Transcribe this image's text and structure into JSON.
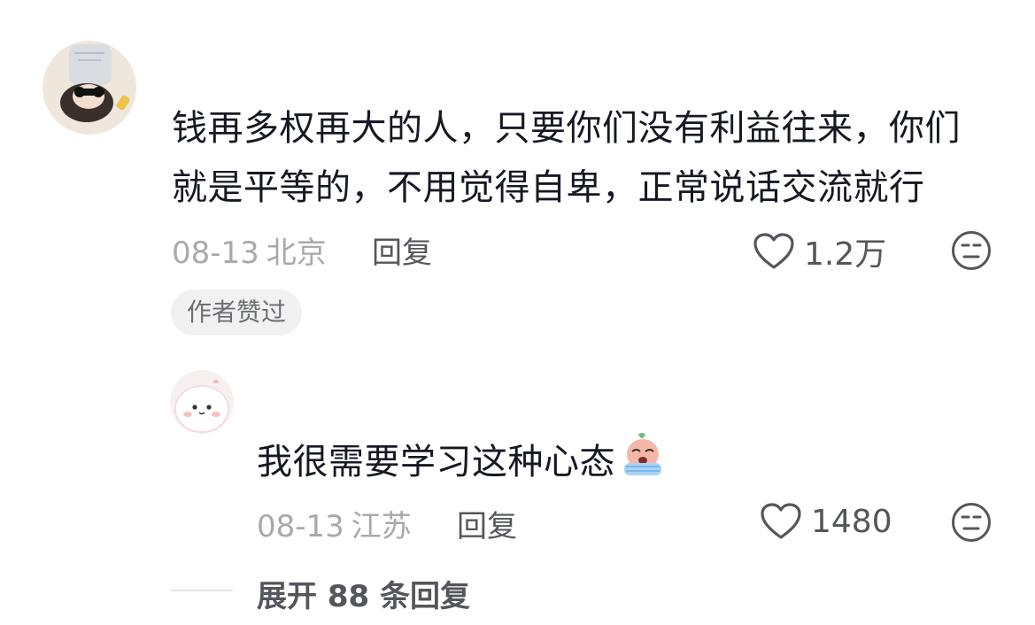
{
  "comment": {
    "username": "",
    "text_line1": "钱再多权再大的人，只要你们没有利益往来，你们",
    "text_line2": "就是平等的，不用觉得自卑，正常说话交流就行",
    "date": "08-13",
    "location": "北京",
    "reply_label": "回复",
    "like_count": "1.2万",
    "author_badge": "作者赞过",
    "colors": {
      "text": "#161823",
      "meta": "#a8a9ad",
      "action": "#54565c"
    }
  },
  "reply": {
    "text": "我很需要学习这种心态",
    "emoji": "crying-emoji",
    "date": "08-13",
    "location": "江苏",
    "reply_label": "回复",
    "like_count": "1480"
  },
  "expand": {
    "label": "展开 88 条回复"
  },
  "icons": [
    "heart-outline-icon",
    "neutral-face-icon"
  ]
}
